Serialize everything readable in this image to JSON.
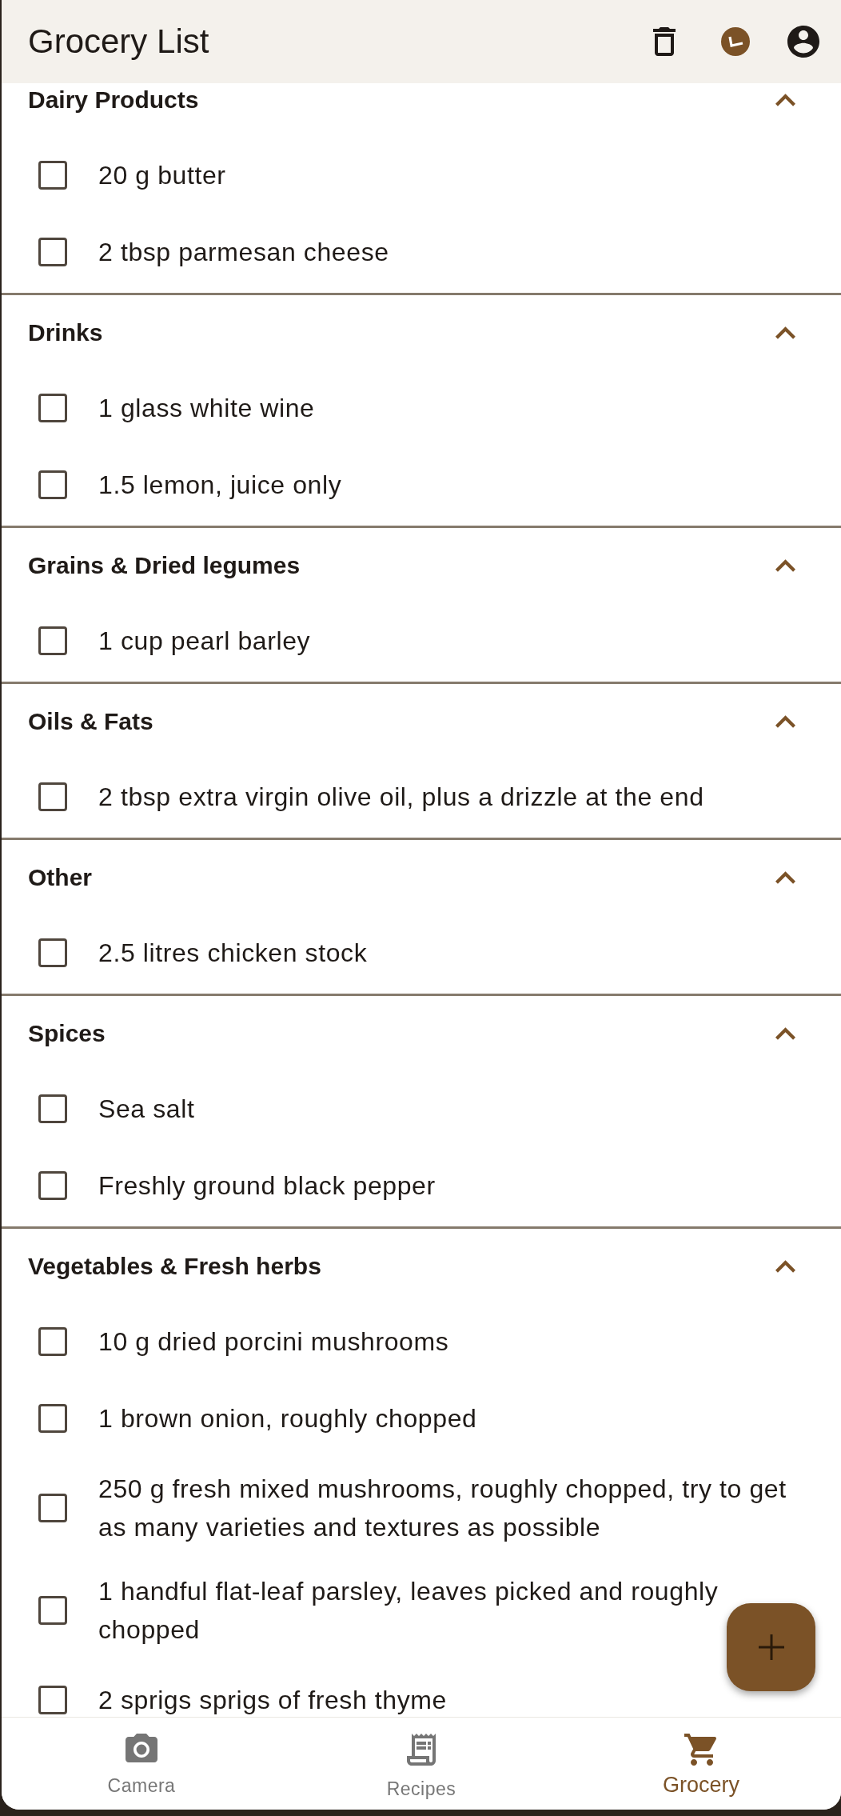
{
  "app_bar": {
    "title": "Grocery List"
  },
  "sections": [
    {
      "title": "Dairy Products",
      "expanded": true,
      "items": [
        {
          "text": "20 g butter",
          "checked": false
        },
        {
          "text": "2 tbsp parmesan cheese",
          "checked": false
        }
      ]
    },
    {
      "title": "Drinks",
      "expanded": true,
      "items": [
        {
          "text": "1 glass white wine",
          "checked": false
        },
        {
          "text": "1.5 lemon, juice only",
          "checked": false
        }
      ]
    },
    {
      "title": "Grains & Dried legumes",
      "expanded": true,
      "items": [
        {
          "text": "1 cup pearl barley",
          "checked": false
        }
      ]
    },
    {
      "title": "Oils & Fats",
      "expanded": true,
      "items": [
        {
          "text": "2 tbsp extra virgin olive oil, plus a drizzle at the end",
          "checked": false
        }
      ]
    },
    {
      "title": "Other",
      "expanded": true,
      "items": [
        {
          "text": "2.5 litres chicken stock",
          "checked": false
        }
      ]
    },
    {
      "title": "Spices",
      "expanded": true,
      "items": [
        {
          "text": "Sea salt",
          "checked": false
        },
        {
          "text": "Freshly ground black pepper",
          "checked": false
        }
      ]
    },
    {
      "title": "Vegetables & Fresh herbs",
      "expanded": true,
      "items": [
        {
          "text": "10 g dried porcini mushrooms",
          "checked": false
        },
        {
          "text": "1 brown onion, roughly chopped",
          "checked": false
        },
        {
          "text": "250 g fresh mixed mushrooms, roughly chopped, try to get as many varieties and textures as possible",
          "checked": false
        },
        {
          "text": "1 handful flat-leaf parsley, leaves picked and roughly chopped",
          "checked": false
        },
        {
          "text": "2 sprigs sprigs of fresh thyme",
          "checked": false
        }
      ]
    }
  ],
  "bottom_nav": [
    {
      "label": "Camera",
      "selected": false
    },
    {
      "label": "Recipes",
      "selected": false
    },
    {
      "label": "Grocery",
      "selected": true
    }
  ]
}
